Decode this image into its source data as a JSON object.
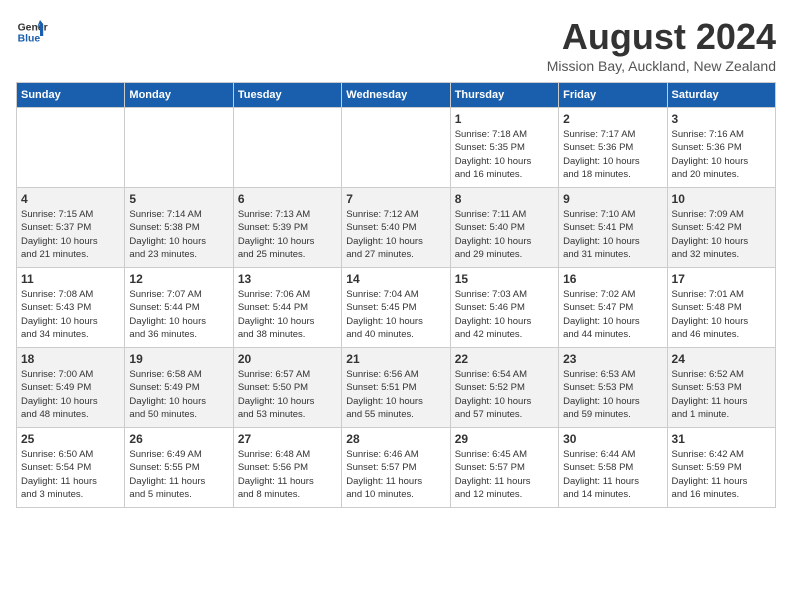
{
  "header": {
    "logo_line1": "General",
    "logo_line2": "Blue",
    "month": "August 2024",
    "location": "Mission Bay, Auckland, New Zealand"
  },
  "weekdays": [
    "Sunday",
    "Monday",
    "Tuesday",
    "Wednesday",
    "Thursday",
    "Friday",
    "Saturday"
  ],
  "weeks": [
    [
      {
        "day": "",
        "info": ""
      },
      {
        "day": "",
        "info": ""
      },
      {
        "day": "",
        "info": ""
      },
      {
        "day": "",
        "info": ""
      },
      {
        "day": "1",
        "info": "Sunrise: 7:18 AM\nSunset: 5:35 PM\nDaylight: 10 hours\nand 16 minutes."
      },
      {
        "day": "2",
        "info": "Sunrise: 7:17 AM\nSunset: 5:36 PM\nDaylight: 10 hours\nand 18 minutes."
      },
      {
        "day": "3",
        "info": "Sunrise: 7:16 AM\nSunset: 5:36 PM\nDaylight: 10 hours\nand 20 minutes."
      }
    ],
    [
      {
        "day": "4",
        "info": "Sunrise: 7:15 AM\nSunset: 5:37 PM\nDaylight: 10 hours\nand 21 minutes."
      },
      {
        "day": "5",
        "info": "Sunrise: 7:14 AM\nSunset: 5:38 PM\nDaylight: 10 hours\nand 23 minutes."
      },
      {
        "day": "6",
        "info": "Sunrise: 7:13 AM\nSunset: 5:39 PM\nDaylight: 10 hours\nand 25 minutes."
      },
      {
        "day": "7",
        "info": "Sunrise: 7:12 AM\nSunset: 5:40 PM\nDaylight: 10 hours\nand 27 minutes."
      },
      {
        "day": "8",
        "info": "Sunrise: 7:11 AM\nSunset: 5:40 PM\nDaylight: 10 hours\nand 29 minutes."
      },
      {
        "day": "9",
        "info": "Sunrise: 7:10 AM\nSunset: 5:41 PM\nDaylight: 10 hours\nand 31 minutes."
      },
      {
        "day": "10",
        "info": "Sunrise: 7:09 AM\nSunset: 5:42 PM\nDaylight: 10 hours\nand 32 minutes."
      }
    ],
    [
      {
        "day": "11",
        "info": "Sunrise: 7:08 AM\nSunset: 5:43 PM\nDaylight: 10 hours\nand 34 minutes."
      },
      {
        "day": "12",
        "info": "Sunrise: 7:07 AM\nSunset: 5:44 PM\nDaylight: 10 hours\nand 36 minutes."
      },
      {
        "day": "13",
        "info": "Sunrise: 7:06 AM\nSunset: 5:44 PM\nDaylight: 10 hours\nand 38 minutes."
      },
      {
        "day": "14",
        "info": "Sunrise: 7:04 AM\nSunset: 5:45 PM\nDaylight: 10 hours\nand 40 minutes."
      },
      {
        "day": "15",
        "info": "Sunrise: 7:03 AM\nSunset: 5:46 PM\nDaylight: 10 hours\nand 42 minutes."
      },
      {
        "day": "16",
        "info": "Sunrise: 7:02 AM\nSunset: 5:47 PM\nDaylight: 10 hours\nand 44 minutes."
      },
      {
        "day": "17",
        "info": "Sunrise: 7:01 AM\nSunset: 5:48 PM\nDaylight: 10 hours\nand 46 minutes."
      }
    ],
    [
      {
        "day": "18",
        "info": "Sunrise: 7:00 AM\nSunset: 5:49 PM\nDaylight: 10 hours\nand 48 minutes."
      },
      {
        "day": "19",
        "info": "Sunrise: 6:58 AM\nSunset: 5:49 PM\nDaylight: 10 hours\nand 50 minutes."
      },
      {
        "day": "20",
        "info": "Sunrise: 6:57 AM\nSunset: 5:50 PM\nDaylight: 10 hours\nand 53 minutes."
      },
      {
        "day": "21",
        "info": "Sunrise: 6:56 AM\nSunset: 5:51 PM\nDaylight: 10 hours\nand 55 minutes."
      },
      {
        "day": "22",
        "info": "Sunrise: 6:54 AM\nSunset: 5:52 PM\nDaylight: 10 hours\nand 57 minutes."
      },
      {
        "day": "23",
        "info": "Sunrise: 6:53 AM\nSunset: 5:53 PM\nDaylight: 10 hours\nand 59 minutes."
      },
      {
        "day": "24",
        "info": "Sunrise: 6:52 AM\nSunset: 5:53 PM\nDaylight: 11 hours\nand 1 minute."
      }
    ],
    [
      {
        "day": "25",
        "info": "Sunrise: 6:50 AM\nSunset: 5:54 PM\nDaylight: 11 hours\nand 3 minutes."
      },
      {
        "day": "26",
        "info": "Sunrise: 6:49 AM\nSunset: 5:55 PM\nDaylight: 11 hours\nand 5 minutes."
      },
      {
        "day": "27",
        "info": "Sunrise: 6:48 AM\nSunset: 5:56 PM\nDaylight: 11 hours\nand 8 minutes."
      },
      {
        "day": "28",
        "info": "Sunrise: 6:46 AM\nSunset: 5:57 PM\nDaylight: 11 hours\nand 10 minutes."
      },
      {
        "day": "29",
        "info": "Sunrise: 6:45 AM\nSunset: 5:57 PM\nDaylight: 11 hours\nand 12 minutes."
      },
      {
        "day": "30",
        "info": "Sunrise: 6:44 AM\nSunset: 5:58 PM\nDaylight: 11 hours\nand 14 minutes."
      },
      {
        "day": "31",
        "info": "Sunrise: 6:42 AM\nSunset: 5:59 PM\nDaylight: 11 hours\nand 16 minutes."
      }
    ]
  ]
}
